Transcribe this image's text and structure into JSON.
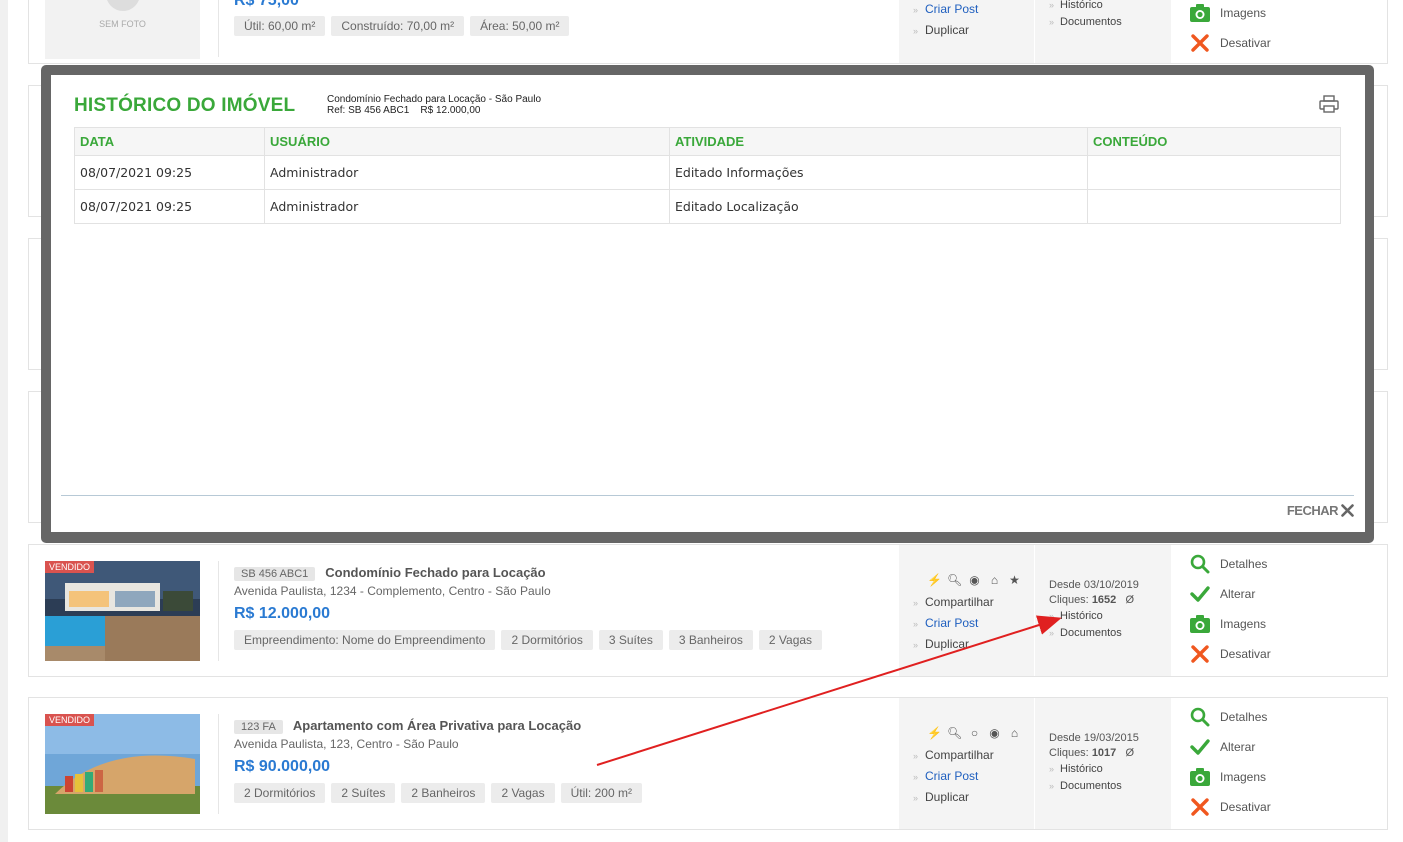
{
  "colors": {
    "accent": "#3aa83a",
    "price": "#2a7ad2",
    "badge": "#d9534f",
    "arrow": "#e02020",
    "link": "#1f5fbf"
  },
  "top_card": {
    "no_photo": "SEM FOTO",
    "price": "R$ 75,00",
    "tags": [
      "Útil: 60,00 m²",
      "Construído: 70,00 m²",
      "Área: 50,00 m²"
    ],
    "actions": [
      "Criar Post",
      "Duplicar"
    ],
    "links": [
      "Histórico",
      "Documentos"
    ],
    "ops": [
      {
        "icon": "camera-icon",
        "label": "Imagens"
      },
      {
        "icon": "close-icon",
        "label": "Desativar"
      }
    ]
  },
  "modal": {
    "title": "HISTÓRICO DO IMÓVEL",
    "subtitle_line1": "Condomínio Fechado para Locação - São Paulo",
    "subtitle_ref": "Ref: SB 456 ABC1",
    "subtitle_price": "R$ 12.000,00",
    "columns": [
      "DATA",
      "USUÁRIO",
      "ATIVIDADE",
      "CONTEÚDO"
    ],
    "rows": [
      [
        "08/07/2021 09:25",
        "Administrador",
        "Editado Informações",
        ""
      ],
      [
        "08/07/2021 09:25",
        "Administrador",
        "Editado Localização",
        ""
      ]
    ],
    "close_label": "FECHAR"
  },
  "listings": [
    {
      "badge": "VENDIDO",
      "ref": "SB 456 ABC1",
      "title": "Condomínio Fechado para Locação",
      "address": "Avenida Paulista, 1234 - Complemento, Centro - São Paulo",
      "price": "R$ 12.000,00",
      "tags": [
        "Empreendimento: Nome do Empreendimento",
        "2 Dormitórios",
        "3 Suítes",
        "3 Banheiros",
        "2 Vagas"
      ],
      "icons": [
        "bolt-icon",
        "search-icon",
        "user-circle-icon",
        "home-icon",
        "star-icon"
      ],
      "actions": [
        "Compartilhar",
        "Criar Post",
        "Duplicar"
      ],
      "since": "Desde 03/10/2019",
      "clicks_label": "Cliques:",
      "clicks": "1652",
      "null_sym": "Ø",
      "links": [
        "Histórico",
        "Documentos"
      ],
      "ops": [
        "Detalhes",
        "Alterar",
        "Imagens",
        "Desativar"
      ]
    },
    {
      "badge": "VENDIDO",
      "ref": "123 FA",
      "title": "Apartamento com Área Privativa para Locação",
      "address": "Avenida Paulista, 123, Centro - São Paulo",
      "price": "R$ 90.000,00",
      "tags": [
        "2 Dormitórios",
        "2 Suítes",
        "2 Banheiros",
        "2 Vagas",
        "Útil: 200 m²"
      ],
      "icons": [
        "bolt-icon",
        "search-icon",
        "user-outline-icon",
        "user-circle-icon",
        "home-icon"
      ],
      "actions": [
        "Compartilhar",
        "Criar Post",
        "Duplicar"
      ],
      "since": "Desde 19/03/2015",
      "clicks_label": "Cliques:",
      "clicks": "1017",
      "null_sym": "Ø",
      "links": [
        "Histórico",
        "Documentos"
      ],
      "ops": [
        "Detalhes",
        "Alterar",
        "Imagens",
        "Desativar"
      ]
    }
  ]
}
